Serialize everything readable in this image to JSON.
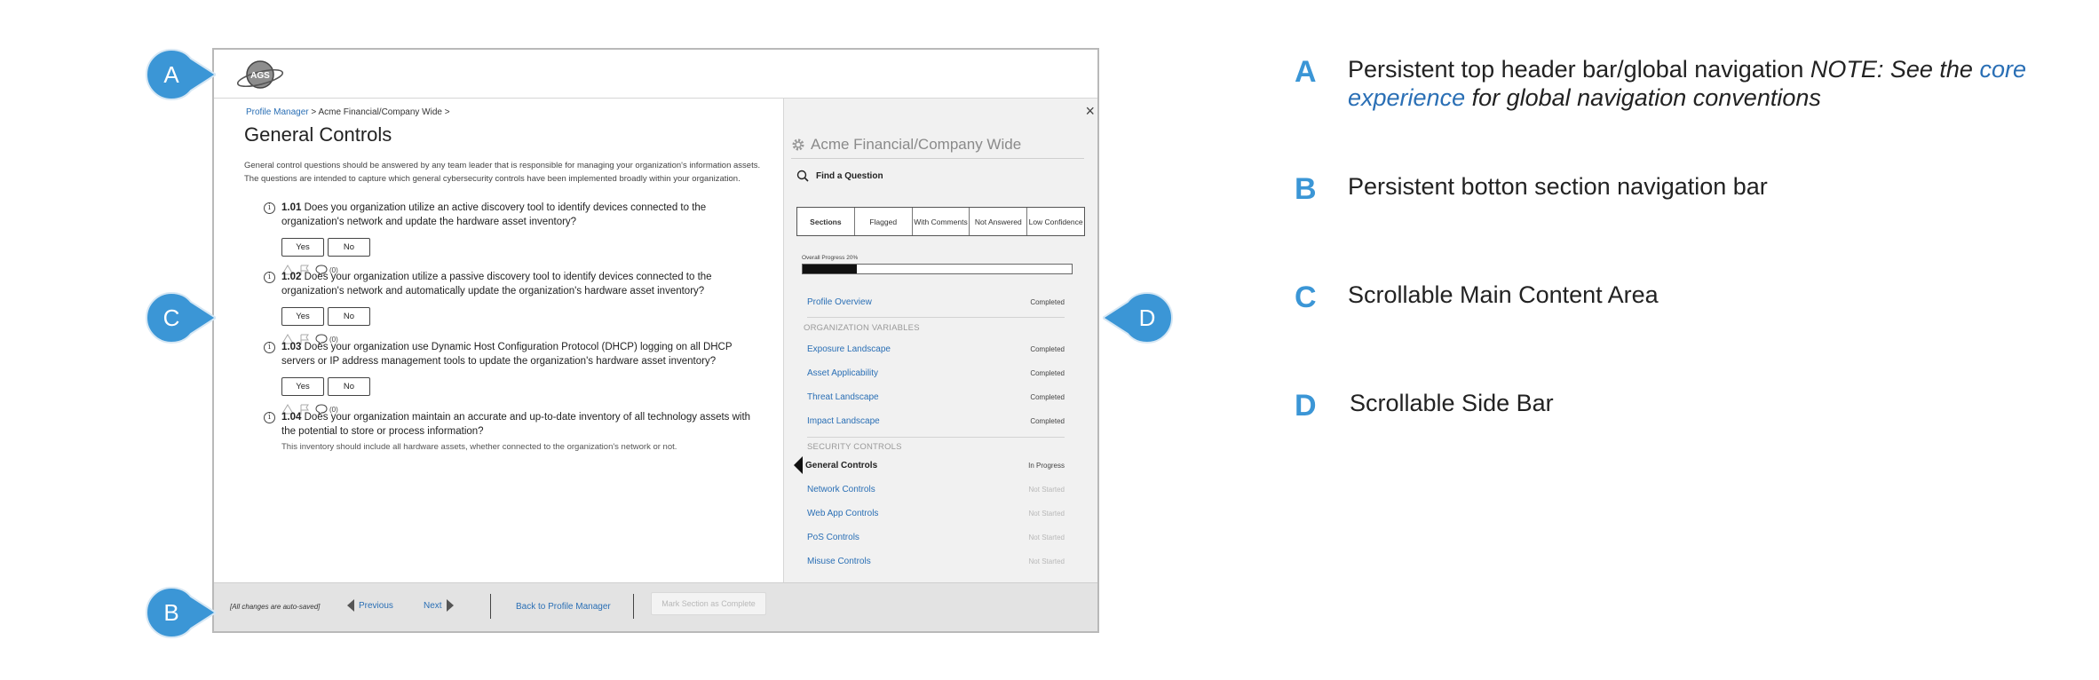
{
  "header": {
    "logo_text": "AGS"
  },
  "main": {
    "breadcrumb": {
      "link": "Profile Manager",
      "rest": " > Acme Financial/Company Wide >"
    },
    "title": "General Controls",
    "intro": "General control questions should be answered by any team leader that is responsible for managing your organization's information assets.  The questions are intended to capture which general cybersecurity controls have been implemented broadly within your organization.",
    "questions": [
      {
        "num": "1.01",
        "text": "Does you organization utilize an active discovery tool to identify devices connected to the organization's network and update the hardware asset inventory?",
        "yes": "Yes",
        "no": "No",
        "comments": "(0)"
      },
      {
        "num": "1.02",
        "text": "Does your organization utilize a passive discovery tool to identify devices connected to the organization's network and automatically update the organization's hardware asset inventory?",
        "yes": "Yes",
        "no": "No",
        "comments": "(0)"
      },
      {
        "num": "1.03",
        "text": "Does your organization use Dynamic Host Configuration Protocol (DHCP) logging on all DHCP servers or IP address management tools to update the organization's hardware asset inventory?",
        "yes": "Yes",
        "no": "No",
        "comments": "(0)"
      },
      {
        "num": "1.04",
        "text": "Does your organization maintain an accurate and up-to-date inventory of all technology assets with the potential to store or process information?",
        "sub": "This inventory should include all hardware assets, whether connected to the organization's network or not."
      }
    ],
    "info_glyph": "i"
  },
  "sidebar": {
    "close_glyph": "×",
    "org_name": "Acme Financial/Company Wide",
    "find_label": "Find a Question",
    "tabs": [
      "Sections",
      "Flagged",
      "With Comments",
      "Not Answered",
      "Low Confidence"
    ],
    "progress_label": "Overall Progress 20%",
    "progress_value": 0.2,
    "profile": {
      "label": "Profile Overview",
      "status": "Completed"
    },
    "org_vars_heading": "ORGANIZATION VARIABLES",
    "org_vars": [
      {
        "label": "Exposure Landscape",
        "status": "Completed"
      },
      {
        "label": "Asset Applicability",
        "status": "Completed"
      },
      {
        "label": "Threat Landscape",
        "status": "Completed"
      },
      {
        "label": "Impact Landscape",
        "status": "Completed"
      }
    ],
    "sec_heading": "SECURITY CONTROLS",
    "sec_controls": [
      {
        "label": "General Controls",
        "status": "In Progress"
      },
      {
        "label": "Network Controls",
        "status": "Not Started"
      },
      {
        "label": "Web App Controls",
        "status": "Not Started"
      },
      {
        "label": "PoS Controls",
        "status": "Not Started"
      },
      {
        "label": "Misuse Controls",
        "status": "Not Started"
      }
    ]
  },
  "bottom": {
    "autosave": "[All changes are auto-saved]",
    "prev": "Previous",
    "next": "Next",
    "back": "Back to Profile Manager",
    "mark": "Mark Section as Complete"
  },
  "callouts": [
    "A",
    "B",
    "C",
    "D"
  ],
  "legend": [
    {
      "letter": "A",
      "text": "Persistent top header bar/global navigation ",
      "note_a": "NOTE: See the ",
      "link": "core experience",
      "note_b": " for global navigation conventions"
    },
    {
      "letter": "B",
      "text": "Persistent botton section navigation bar"
    },
    {
      "letter": "C",
      "text": "Scrollable Main Content Area"
    },
    {
      "letter": "D",
      "text": "Scrollable Side Bar"
    }
  ],
  "colors": {
    "callout": "#3b96d6",
    "link": "#2a6fb5"
  }
}
